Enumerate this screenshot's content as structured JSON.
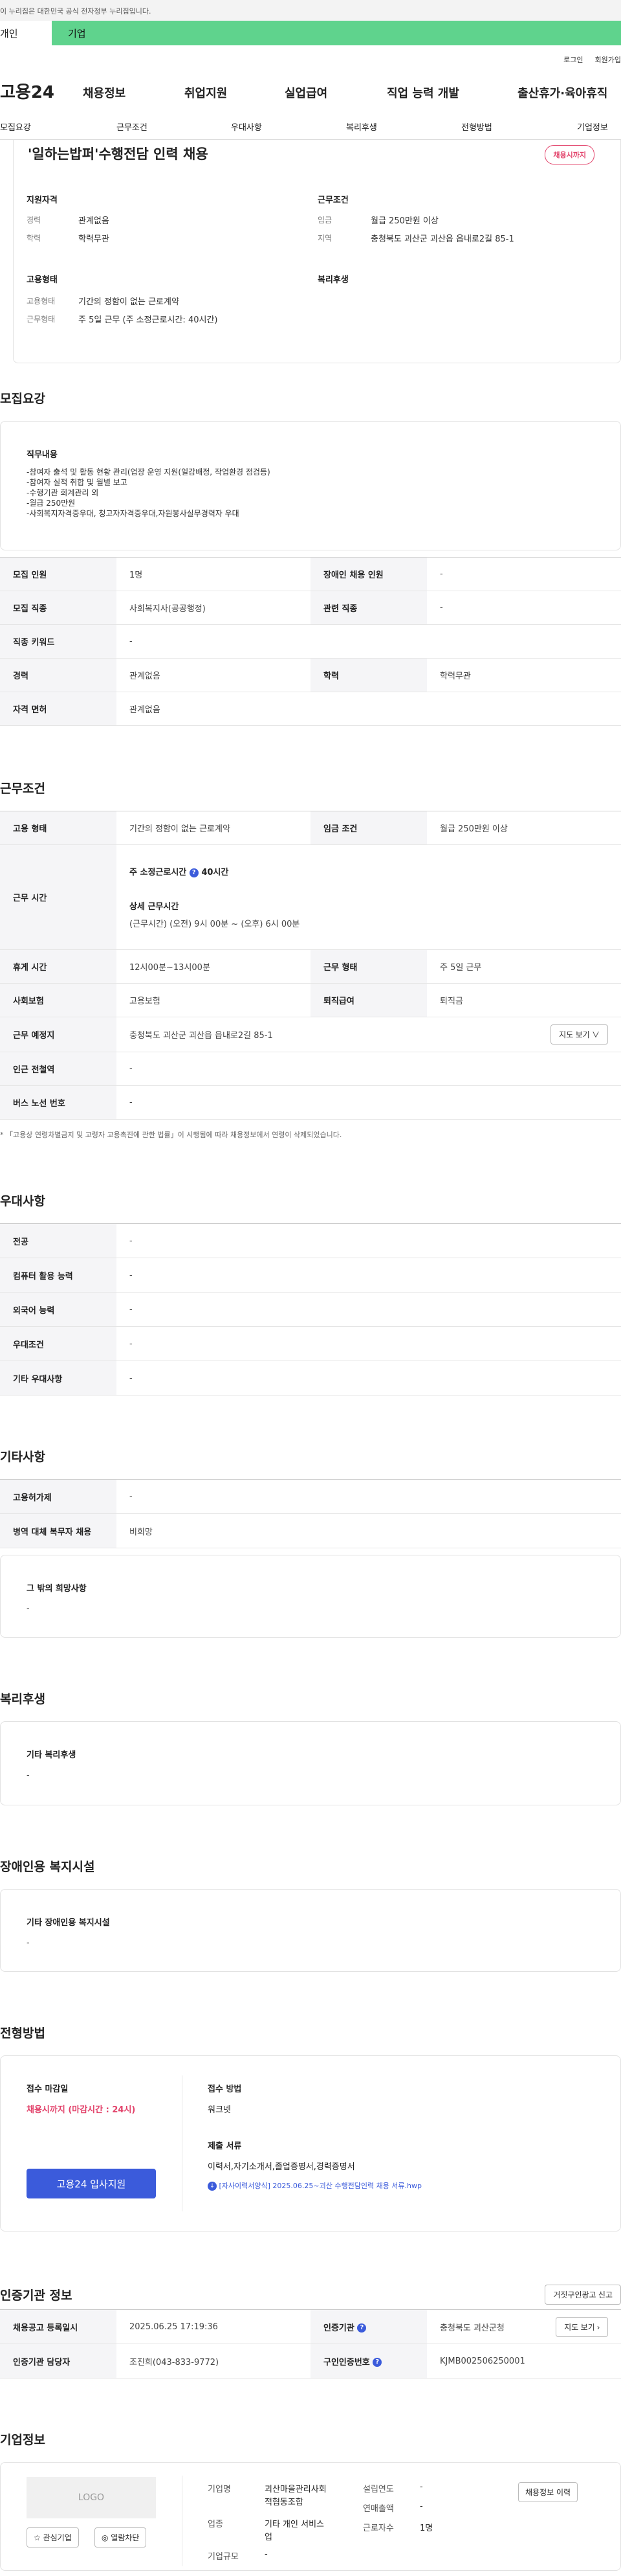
{
  "topbar": {
    "notice": "이 누리집은 대한민국 공식 전자정부 누리집입니다."
  },
  "segtabs": {
    "individual": "개인",
    "company": "기업"
  },
  "util": {
    "login": "로그인",
    "join": "회원가입"
  },
  "gnb": {
    "logo": "고용24",
    "items": [
      "채용정보",
      "취업지원",
      "실업급여",
      "직업 능력 개발",
      "출산휴가·육아휴직"
    ]
  },
  "subnav": {
    "items": [
      "모집요강",
      "근무조건",
      "우대사항",
      "복리후생",
      "전형방법",
      "기업정보"
    ]
  },
  "summary": {
    "title": "'일하는밥퍼'수행전담 인력 채용",
    "badge": "채용시까지",
    "qual": {
      "heading": "지원자격",
      "career_k": "경력",
      "career_v": "관계없음",
      "edu_k": "학력",
      "edu_v": "학력무관"
    },
    "cond": {
      "heading": "근무조건",
      "wage_k": "임금",
      "wage_v": "월급 250만원 이상",
      "area_k": "지역",
      "area_v": "충청북도 괴산군 괴산읍 읍내로2길 85-1"
    },
    "emp": {
      "heading": "고용형태",
      "type_k": "고용형태",
      "type_v": "기간의 정함이 없는 근로계약",
      "form_k": "근무형태",
      "form_v": "주 5일 근무 (주 소정근로시간: 40시간)"
    },
    "welfare": {
      "heading": "복리후생"
    }
  },
  "recruit": {
    "title": "모집요강",
    "duty_heading": "직무내용",
    "duty_lines": [
      "-참여자 출석 및 활동 현황 관리(업장 운영 지원(일감배정, 작업환경 점검등)",
      "-참여자 실적 취합 및 월별 보고",
      "-수행기관 회계관리 외",
      "-월급 250만원",
      "-사회복지자격증우대, 청고자자격증우대,자원봉사실무경력자 우대"
    ],
    "rows": {
      "count_k": "모집 인원",
      "count_v": "1명",
      "disabled_k": "장애인 채용 인원",
      "disabled_v": "-",
      "job_k": "모집 직종",
      "job_v": "사회복지사(공공행정)",
      "related_k": "관련 직종",
      "related_v": "-",
      "kw_k": "직종 키워드",
      "kw_v": "-",
      "career_k": "경력",
      "career_v": "관계없음",
      "edu_k": "학력",
      "edu_v": "학력무관",
      "license_k": "자격 면허",
      "license_v": "관계없음"
    }
  },
  "work": {
    "title": "근무조건",
    "emp_k": "고용 형태",
    "emp_v": "기간의 정함이 없는 근로계약",
    "wage_k": "임금 조건",
    "wage_v": "월급 250만원 이상",
    "hours_k": "근무 시간",
    "hours_week": "주 소정근로시간",
    "hours_week_v": "40시간",
    "hours_detail_h": "상세 근무시간",
    "hours_detail_v": "(근무시간) (오전) 9시 00분 ~ (오후) 6시 00분",
    "rest_k": "휴게 시간",
    "rest_v": "12시00분~13시00분",
    "form_k": "근무 형태",
    "form_v": "주 5일 근무",
    "ins_k": "사회보험",
    "ins_v": "고용보험",
    "retire_k": "퇴직급여",
    "retire_v": "퇴직금",
    "place_k": "근무 예정지",
    "place_v": "충청북도 괴산군 괴산읍 읍내로2길 85-1",
    "map_btn": "지도 보기 ∨",
    "subway_k": "인근 전철역",
    "subway_v": "-",
    "bus_k": "버스 노선 번호",
    "bus_v": "-",
    "note": "* 「고용상 연령차별금지 및 고령자 고용촉진에 관한 법률」이 시행됨에 따라 채용정보에서 연령이 삭제되었습니다."
  },
  "pref": {
    "title": "우대사항",
    "major_k": "전공",
    "major_v": "-",
    "pc_k": "컴퓨터 활용 능력",
    "pc_v": "-",
    "lang_k": "외국어 능력",
    "lang_v": "-",
    "cond_k": "우대조건",
    "cond_v": "-",
    "etc_k": "기타 우대사항",
    "etc_v": "-"
  },
  "other": {
    "title": "기타사항",
    "permit_k": "고용허가제",
    "permit_v": "-",
    "military_k": "병역 대체 복무자 채용",
    "military_v": "비희망",
    "wish_h": "그 밖의 희망사항",
    "wish_v": "-"
  },
  "welfare": {
    "title": "복리후생",
    "etc_h": "기타 복리후생",
    "etc_v": "-"
  },
  "facility": {
    "title": "장애인용 복지시설",
    "etc_h": "기타 장애인용 복지시설",
    "etc_v": "-"
  },
  "process": {
    "title": "전형방법",
    "deadline_h": "접수 마감일",
    "deadline_v": "채용시까지 (마감시간 : 24시)",
    "method_h": "접수 방법",
    "method_v": "워크넷",
    "apply_btn": "고용24 입사지원",
    "docs_h": "제출 서류",
    "docs_v": "이력서,자기소개서,졸업증명서,경력증명서",
    "file": "[자사이력서양식] 2025.06.25~괴산 수행전담인력 채용 서류.hwp"
  },
  "agency": {
    "title": "인증기관 정보",
    "report_btn": "거짓구인광고 신고",
    "reg_k": "채용공고 등록일시",
    "reg_v": "2025.06.25 17:19:36",
    "org_k": "인증기관",
    "org_v": "충청북도 괴산군청",
    "map_btn": "지도 보기 ›",
    "manager_k": "인증기관 담당자",
    "manager_v": "조진희(043-833-9772)",
    "num_k": "구인인증번호",
    "num_v": "KJMB002506250001"
  },
  "company": {
    "title": "기업정보",
    "logo": "LOGO",
    "fav_btn": "☆ 관심기업",
    "block_btn": "◎ 열람차단",
    "name_k": "기업명",
    "name_v1": "괴산마을관리사회",
    "name_v2": "적협동조합",
    "est_k": "설립연도",
    "est_v": "-",
    "sales_k": "연매출액",
    "sales_v": "-",
    "biz_k": "업종",
    "biz_v1": "기타 개인 서비스",
    "biz_v2": "업",
    "emp_k": "근로자수",
    "emp_v": "1명",
    "size_k": "기업규모",
    "size_v": "-",
    "history_btn": "채용정보 이력"
  }
}
